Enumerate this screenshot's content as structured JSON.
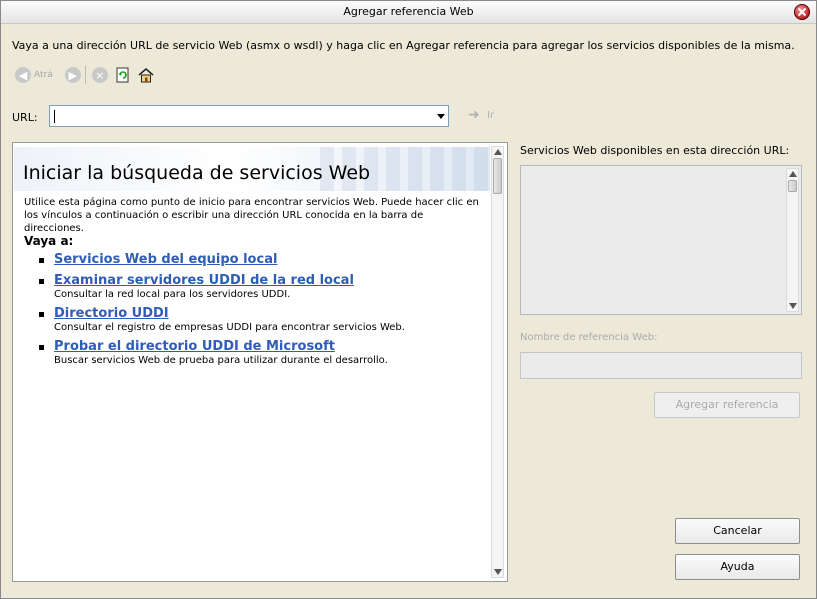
{
  "window": {
    "title": "Agregar referencia Web"
  },
  "instructions": "Vaya a una dirección URL de servicio Web (asmx o wsdl) y haga clic en Agregar referencia para agregar los servicios disponibles de la misma.",
  "toolbar": {
    "back_label": "Atrá"
  },
  "url": {
    "label": "URL:",
    "value": "",
    "go_label": "Ir"
  },
  "browser": {
    "heading": "Iniciar la búsqueda de servicios Web",
    "intro": "Utilice esta página como punto de inicio para encontrar servicios Web. Puede hacer clic en los vínculos a continuación o escribir una dirección URL conocida en la barra de direcciones.",
    "goto_label": "Vaya a:",
    "links": [
      {
        "label": "Servicios Web del equipo local",
        "desc": ""
      },
      {
        "label": "Examinar servidores UDDI de la red local",
        "desc": "Consultar la red local para los servidores UDDI."
      },
      {
        "label": "Directorio UDDI",
        "desc": "Consultar el registro de empresas UDDI para encontrar servicios Web."
      },
      {
        "label": "Probar el directorio UDDI de Microsoft",
        "desc": "Buscar servicios Web de prueba para utilizar durante el desarrollo."
      }
    ]
  },
  "services": {
    "label": "Servicios Web disponibles en esta dirección URL:"
  },
  "reference": {
    "label": "Nombre de referencia Web:",
    "value": ""
  },
  "buttons": {
    "add": "Agregar referencia",
    "cancel": "Cancelar",
    "help": "Ayuda"
  },
  "colors": {
    "link": "#2e5db3",
    "window_bg": "#ECE9D8"
  }
}
